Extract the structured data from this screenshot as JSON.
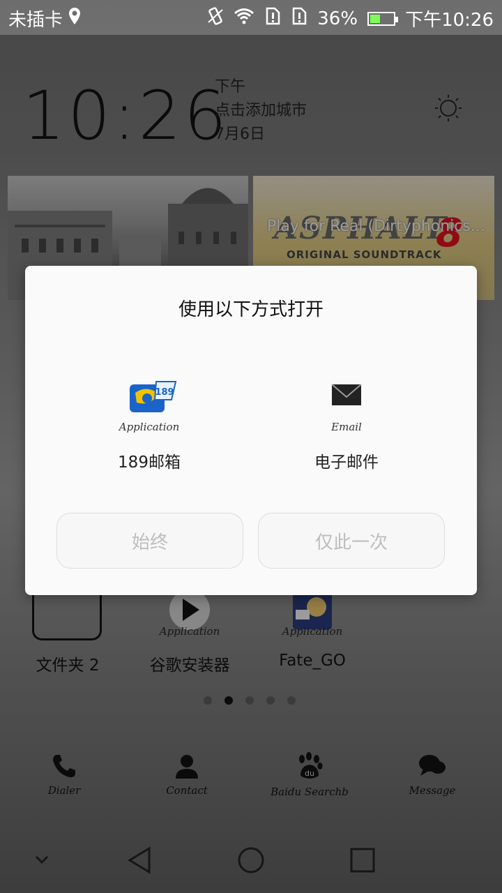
{
  "status_bar": {
    "carrier": "未插卡",
    "battery": "36%",
    "time": "下午10:26"
  },
  "clock_widget": {
    "time": "10:26",
    "ampm": "下午",
    "city_prompt": "点击添加城市",
    "date": "7月6日"
  },
  "cards": {
    "right_title": "Play for Real (Dirtyphonics...",
    "asphalt_title": "ASPHALT",
    "asphalt_sub": "ORIGINAL SOUNDTRACK",
    "asphalt_num": "8"
  },
  "dialog": {
    "title": "使用以下方式打开",
    "options": [
      {
        "caption": "Application",
        "label": "189邮箱"
      },
      {
        "caption": "Email",
        "label": "电子邮件"
      }
    ],
    "buttons": {
      "always": "始终",
      "once": "仅此一次"
    }
  },
  "home_apps": [
    {
      "label": "文件夹 2"
    },
    {
      "caption": "Application",
      "label": "谷歌安装器"
    },
    {
      "caption": "Application",
      "label": "Fate_GO"
    }
  ],
  "dock": [
    {
      "caption": "Dialer"
    },
    {
      "caption": "Contact"
    },
    {
      "caption": "Baidu Searchb"
    },
    {
      "caption": "Message"
    }
  ],
  "colors": {
    "battery_fill": "#7cfc5a",
    "dialog_bg": "#fafafa",
    "button_text_disabled": "#bdbdbd"
  }
}
